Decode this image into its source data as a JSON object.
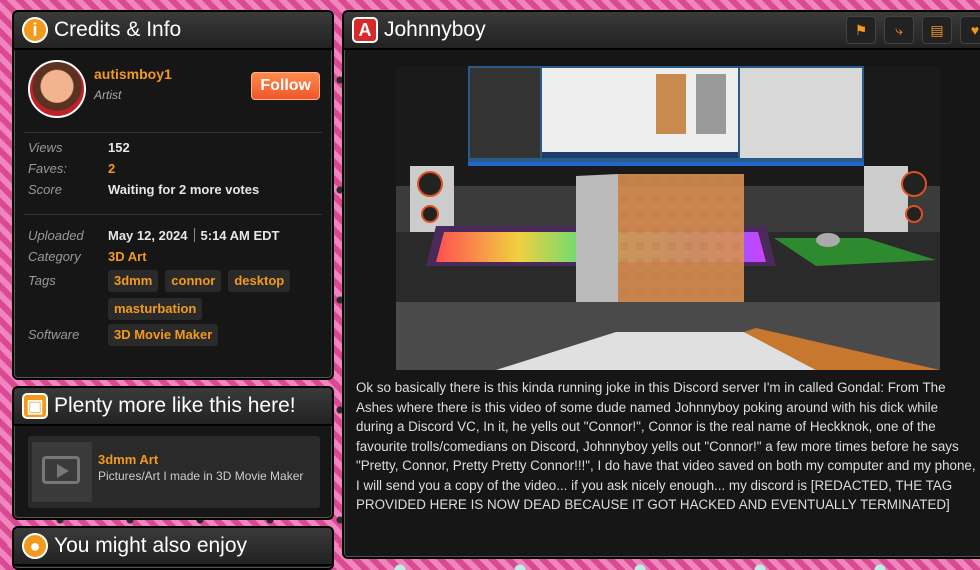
{
  "credits": {
    "title": "Credits & Info",
    "user": {
      "name": "autismboy1",
      "role": "Artist"
    },
    "follow_label": "Follow",
    "stats": [
      {
        "label": "Views",
        "value": "152"
      },
      {
        "label": "Faves:",
        "value": "2"
      },
      {
        "label": "Score",
        "value": "Waiting for 2 more votes"
      }
    ],
    "uploaded": {
      "label": "Uploaded",
      "date": "May 12, 2024",
      "time": "5:14 AM EDT"
    },
    "category": {
      "label": "Category",
      "value": "3D Art"
    },
    "tags": {
      "label": "Tags",
      "items": [
        "3dmm",
        "connor",
        "desktop",
        "masturbation"
      ]
    },
    "software": {
      "label": "Software",
      "value": "3D Movie Maker"
    }
  },
  "more": {
    "title": "Plenty more like this here!",
    "card_title": "3dmm Art",
    "card_sub": "Pictures/Art I made in 3D Movie Maker"
  },
  "enjoy": {
    "title": "You might also enjoy"
  },
  "main": {
    "title": "Johnnyboy",
    "description": "Ok so basically there is this kinda running joke in this Discord server I'm in called Gondal: From The Ashes where there is this video of some dude named Johnnyboy poking around with his dick while during a Discord VC, In it, he yells out \"Connor!\", Connor is the real name of Heckknok, one of the favourite trolls/comedians on Discord, Johnnyboy yells out \"Connor!\" a few more times before he says \"Pretty, Connor, Pretty Pretty Connor!!!\", I do have that video saved on both my computer and my phone, I will send you a copy of the video... if you ask nicely enough... my discord is [REDACTED, THE TAG PROVIDED HERE IS NOW DEAD BECAUSE IT GOT HACKED AND EVENTUALLY TERMINATED]"
  },
  "icons": {
    "credits": "info-icon",
    "more": "glasses-icon",
    "main": "artist-a-icon",
    "toolbar": [
      "flag-icon",
      "share-icon",
      "chat-icon",
      "heart-icon"
    ]
  },
  "colors": {
    "accent": "#f39a1d",
    "follow": "#f0562a",
    "panel": "#161616"
  }
}
